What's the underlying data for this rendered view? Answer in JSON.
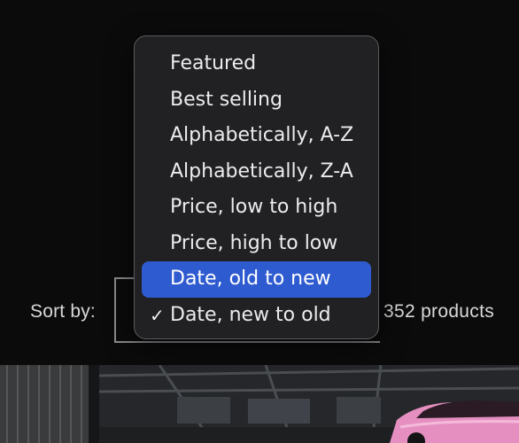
{
  "sort": {
    "label": "Sort by:",
    "selected": "Date, new to old",
    "options": [
      "Featured",
      "Best selling",
      "Alphabetically, A-Z",
      "Alphabetically, Z-A",
      "Price, low to high",
      "Price, high to low",
      "Date, old to new",
      "Date, new to old"
    ],
    "highlighted": "Date, old to new"
  },
  "product_count": "352 products",
  "icons": {
    "checkmark": "checkmark-icon"
  },
  "colors": {
    "highlight": "#2f5bd0",
    "menu_background": "#222224",
    "page_background": "#0b0b0c"
  }
}
